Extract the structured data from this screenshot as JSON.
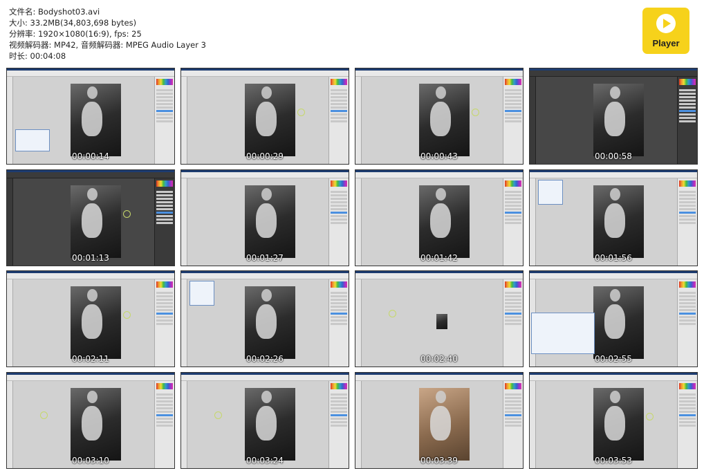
{
  "file_info": {
    "filename": "文件名: Bodyshot03.avi",
    "size": "大小: 33.2MB(34,803,698 bytes)",
    "resolution": "分辨率: 1920×1080(16:9), fps: 25",
    "codecs": "视频解码器: MP42, 音频解码器: MPEG Audio Layer 3",
    "duration": "时长: 00:04:08"
  },
  "player_badge": {
    "label": "Player",
    "color": "#f6d21b"
  },
  "thumbnails": [
    {
      "time": "00:00:14",
      "theme": "light",
      "photo": "bw",
      "dialog": "left"
    },
    {
      "time": "00:00:29",
      "theme": "light",
      "photo": "bw",
      "ring": "right"
    },
    {
      "time": "00:00:43",
      "theme": "light",
      "photo": "bw",
      "ring": "right"
    },
    {
      "time": "00:00:58",
      "theme": "dark",
      "photo": "bw"
    },
    {
      "time": "00:01:13",
      "theme": "dark",
      "photo": "bw",
      "ring": "right"
    },
    {
      "time": "00:01:27",
      "theme": "light",
      "photo": "bw"
    },
    {
      "time": "00:01:42",
      "theme": "light",
      "photo": "bw"
    },
    {
      "time": "00:01:56",
      "theme": "light",
      "photo": "bw",
      "menu": "left"
    },
    {
      "time": "00:02:11",
      "theme": "light",
      "photo": "bw",
      "ring": "right"
    },
    {
      "time": "00:02:26",
      "theme": "light",
      "photo": "bw",
      "menu": "left"
    },
    {
      "time": "00:02:40",
      "theme": "light",
      "photo": "small",
      "ring": "left"
    },
    {
      "time": "00:02:55",
      "theme": "light",
      "photo": "bw",
      "dialog": "wide"
    },
    {
      "time": "00:03:10",
      "theme": "light",
      "photo": "bw",
      "ring": "left"
    },
    {
      "time": "00:03:24",
      "theme": "light",
      "photo": "bw",
      "ring": "left"
    },
    {
      "time": "00:03:39",
      "theme": "light",
      "photo": "warm"
    },
    {
      "time": "00:03:53",
      "theme": "light",
      "photo": "bw",
      "ring": "right"
    }
  ]
}
